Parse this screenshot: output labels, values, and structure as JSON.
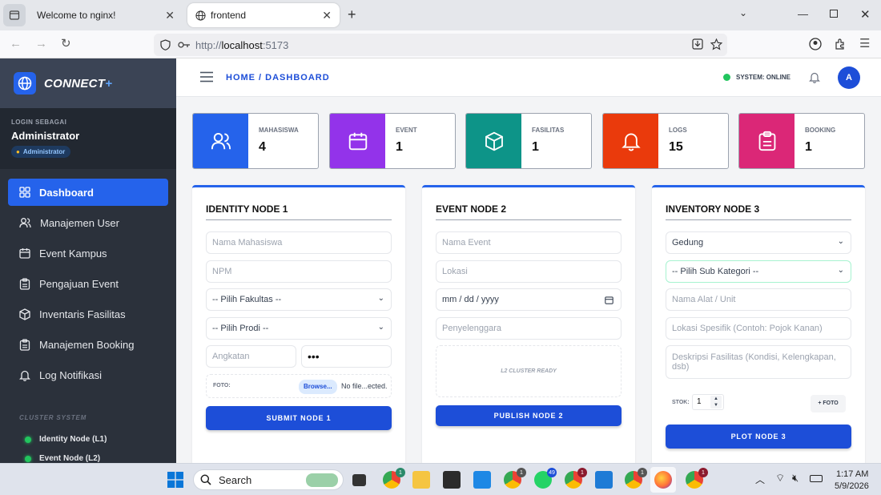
{
  "browser": {
    "tabs": [
      {
        "title": "Welcome to nginx!",
        "active": false
      },
      {
        "title": "frontend",
        "active": true
      }
    ],
    "url": "http://localhost:5173",
    "url_host_prefix": "http://",
    "url_host": "localhost",
    "url_port": ":5173"
  },
  "sidebar": {
    "brand": "CONNECT",
    "brand_suffix": "+",
    "login_label": "LOGIN SEBAGAI",
    "user_name": "Administrator",
    "role_badge": "Administrator",
    "nav": [
      {
        "label": "Dashboard",
        "icon": "grid-icon",
        "active": true
      },
      {
        "label": "Manajemen User",
        "icon": "users-icon",
        "active": false
      },
      {
        "label": "Event Kampus",
        "icon": "calendar-icon",
        "active": false
      },
      {
        "label": "Pengajuan Event",
        "icon": "clipboard-icon",
        "active": false
      },
      {
        "label": "Inventaris Fasilitas",
        "icon": "box-icon",
        "active": false
      },
      {
        "label": "Manajemen Booking",
        "icon": "clipboard-icon",
        "active": false
      },
      {
        "label": "Log Notifikasi",
        "icon": "bell-icon",
        "active": false
      }
    ],
    "cluster_title": "CLUSTER SYSTEM",
    "cluster_items": [
      "Identity Node (L1)",
      "Event Node (L2)"
    ]
  },
  "header": {
    "breadcrumb": "HOME / DASHBOARD",
    "status": "SYSTEM: ONLINE",
    "avatar_letter": "A"
  },
  "stats": [
    {
      "label": "MAHASISWA",
      "value": "4",
      "color": "#2563eb",
      "icon": "users-icon"
    },
    {
      "label": "EVENT",
      "value": "1",
      "color": "#9333ea",
      "icon": "calendar-icon"
    },
    {
      "label": "FASILITAS",
      "value": "1",
      "color": "#0d9488",
      "icon": "box-icon"
    },
    {
      "label": "LOGS",
      "value": "15",
      "color": "#ea3a0c",
      "icon": "bell-icon"
    },
    {
      "label": "BOOKING",
      "value": "1",
      "color": "#db2777",
      "icon": "clipboard-icon"
    }
  ],
  "node1": {
    "title": "IDENTITY NODE 1",
    "nama_placeholder": "Nama Mahasiswa",
    "npm_placeholder": "NPM",
    "fakultas": "-- Pilih Fakultas --",
    "prodi": "-- Pilih Prodi --",
    "angkatan_placeholder": "Angkatan",
    "password_value": "•••",
    "foto_label": "FOTO:",
    "browse": "Browse...",
    "file_status": "No file...ected.",
    "submit": "SUBMIT NODE 1"
  },
  "node2": {
    "title": "EVENT NODE 2",
    "nama_placeholder": "Nama Event",
    "lokasi_placeholder": "Lokasi",
    "date_placeholder": "mm / dd / yyyy",
    "penyelenggara_placeholder": "Penyelenggara",
    "cluster_ready": "L2 CLUSTER READY",
    "submit": "PUBLISH NODE 2"
  },
  "node3": {
    "title": "INVENTORY NODE 3",
    "kategori": "Gedung",
    "sub_kategori": "-- Pilih Sub Kategori --",
    "nama_placeholder": "Nama Alat / Unit",
    "lokasi_placeholder": "Lokasi Spesifik (Contoh: Pojok Kanan)",
    "deskripsi_placeholder": "Deskripsi Fasilitas (Kondisi, Kelengkapan, dsb)",
    "stok_label": "STOK:",
    "stok_value": "1",
    "foto_button": "+ FOTO",
    "submit": "PLOT NODE 3"
  },
  "taskbar": {
    "search": "Search",
    "time": "1:17 AM",
    "date": "5/9/2026",
    "badges": [
      "1",
      "1",
      "49",
      "1",
      "1",
      "1"
    ]
  }
}
